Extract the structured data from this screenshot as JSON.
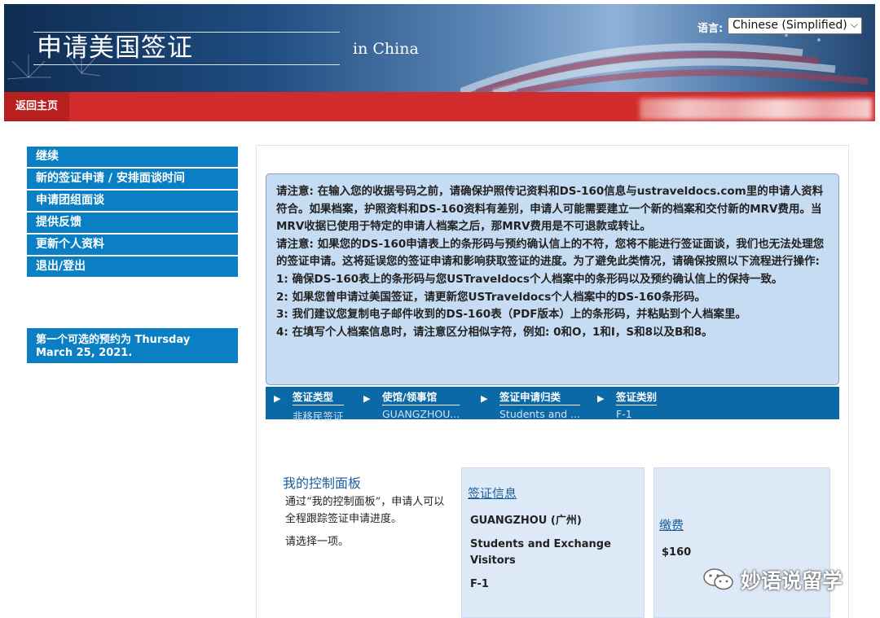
{
  "header": {
    "title": "申请美国签证",
    "subtitle": "in China",
    "language_label": "语言:",
    "language_selected": "Chinese (Simplified)"
  },
  "nav": {
    "home": "返回主页"
  },
  "sidebar": {
    "items": [
      {
        "label": "继续"
      },
      {
        "label": "新的签证申请 / 安排面谈时间"
      },
      {
        "label": "申请团组面谈"
      },
      {
        "label": "提供反馈"
      },
      {
        "label": "更新个人资料"
      },
      {
        "label": "退出/登出"
      }
    ],
    "first_appointment": "第一个可选的预约为 Thursday March 25, 2021."
  },
  "notice": {
    "paragraphs": [
      "请注意: 在输入您的收据号码之前，请确保护照传记资料和DS-160信息与ustraveldocs.com里的申请人资料符合。如果档案，护照资料和DS-160资料有差别，申请人可能需要建立一个新的档案和交付新的MRV费用。当MRV收据已使用于特定的申请人档案之后，那MRV费用是不可退款或转让。",
      "请注意: 如果您的DS-160申请表上的条形码与预约确认信上的不符，您将不能进行签证面谈，我们也无法处理您的签证申请。这将延误您的签证申请和影响获取签证的进度。为了避免此类情况，请确保按照以下流程进行操作:",
      "1: 确保DS-160表上的条形码与您USTraveldocs个人档案中的条形码以及预约确认信上的保持一致。",
      "2: 如果您曾申请过美国签证，请更新您USTraveldocs个人档案中的DS-160条形码。",
      "3: 我们建议您复制电子邮件收到的DS-160表（PDF版本）上的条形码，并粘贴到个人档案里。",
      "4: 在填写个人档案信息时，请注意区分相似字符，例如: 0和O，1和I，S和8以及B和8。"
    ]
  },
  "steps": [
    {
      "label": "签证类型",
      "value": "非移民签证"
    },
    {
      "label": "使馆/领事馆",
      "value": "GUANGZHOU..."
    },
    {
      "label": "签证申请归类",
      "value": "Students and ..."
    },
    {
      "label": "签证类别",
      "value": "F-1"
    }
  ],
  "dashboard": {
    "title": "我的控制面板",
    "description": "通过“我的控制面板”，申请人可以全程跟踪签证申请进度。",
    "choose": "请选择一项。"
  },
  "visa_info": {
    "link": "签证信息",
    "post": "GUANGZHOU (广州)",
    "category": "Students and Exchange Visitors",
    "class": "F-1"
  },
  "fee": {
    "link": "缴费",
    "amount": "$160"
  },
  "watermark": {
    "text": "妙语说留学"
  },
  "colors": {
    "sidebar_blue": "#0b7fc4",
    "nav_red": "#d22b2b",
    "notice_bg": "#c6dcf2",
    "steps_bg": "#0b69a8"
  }
}
